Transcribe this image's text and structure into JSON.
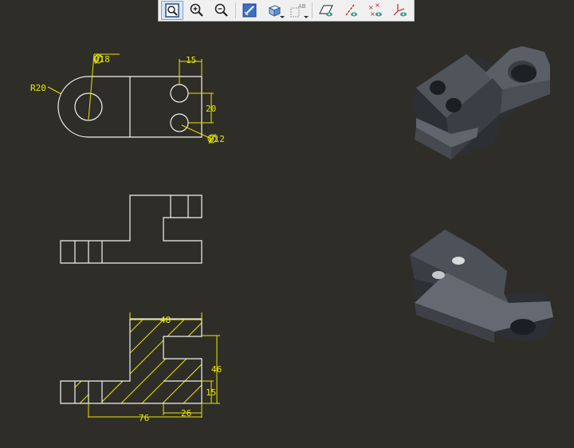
{
  "toolbar": {
    "buttons": [
      {
        "name": "zoom-fit-button",
        "icon": "zoom-fit-icon"
      },
      {
        "name": "zoom-in-button",
        "icon": "zoom-in-icon"
      },
      {
        "name": "zoom-out-button",
        "icon": "zoom-out-icon"
      },
      {
        "name": "repaint-button",
        "icon": "repaint-icon"
      },
      {
        "name": "display-style-button",
        "icon": "shaded-cube-icon"
      },
      {
        "name": "saved-views-button",
        "icon": "saved-views-icon"
      },
      {
        "name": "plane-display-button",
        "icon": "plane-display-icon"
      },
      {
        "name": "axis-display-button",
        "icon": "axis-display-icon"
      },
      {
        "name": "point-display-button",
        "icon": "point-display-icon"
      },
      {
        "name": "csys-display-button",
        "icon": "csys-display-icon"
      }
    ],
    "saved_views_label": "AB"
  },
  "drawing": {
    "top_view": {
      "dim_diameter_large": "Ø18",
      "dim_radius": "R20",
      "dim_hole_offset": "15",
      "dim_hole_spacing": "20",
      "dim_diameter_small": "Ø12"
    },
    "section_view": {
      "dim_top_width": "48",
      "dim_height": "46",
      "dim_step_height": "15",
      "dim_slot_width": "26",
      "dim_total_length": "76"
    }
  },
  "colors": {
    "background": "#2f2d28",
    "line": "#f2f2f2",
    "dimension": "#e8e800",
    "model": "#5c6168"
  }
}
